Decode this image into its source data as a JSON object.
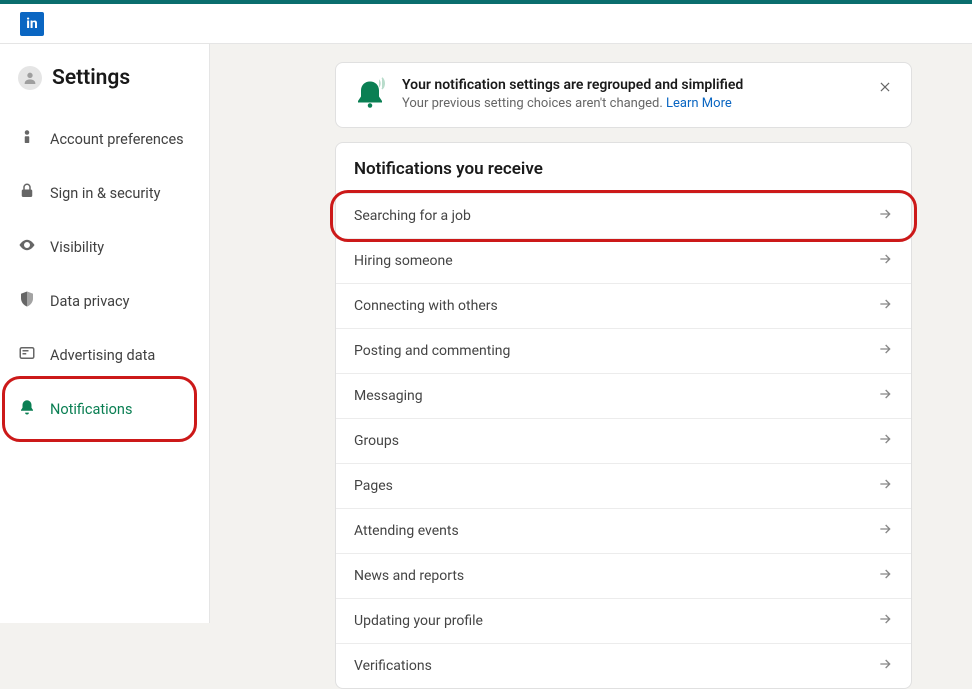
{
  "logo_text": "in",
  "page_title": "Settings",
  "sidebar": {
    "items": [
      {
        "label": "Account preferences",
        "name": "sidebar-item-account-preferences",
        "icon": "user-dots"
      },
      {
        "label": "Sign in & security",
        "name": "sidebar-item-sign-in-security",
        "icon": "lock"
      },
      {
        "label": "Visibility",
        "name": "sidebar-item-visibility",
        "icon": "eye"
      },
      {
        "label": "Data privacy",
        "name": "sidebar-item-data-privacy",
        "icon": "shield"
      },
      {
        "label": "Advertising data",
        "name": "sidebar-item-advertising-data",
        "icon": "ad"
      },
      {
        "label": "Notifications",
        "name": "sidebar-item-notifications",
        "icon": "bell",
        "active": true,
        "highlight": true
      }
    ]
  },
  "banner": {
    "title": "Your notification settings are regrouped and simplified",
    "subtitle": "Your previous setting choices aren't changed. ",
    "link_text": "Learn More"
  },
  "section_title": "Notifications you receive",
  "items": [
    {
      "label": "Searching for a job",
      "highlight": true
    },
    {
      "label": "Hiring someone"
    },
    {
      "label": "Connecting with others"
    },
    {
      "label": "Posting and commenting"
    },
    {
      "label": "Messaging"
    },
    {
      "label": "Groups"
    },
    {
      "label": "Pages"
    },
    {
      "label": "Attending events"
    },
    {
      "label": "News and reports"
    },
    {
      "label": "Updating your profile"
    },
    {
      "label": "Verifications"
    }
  ]
}
